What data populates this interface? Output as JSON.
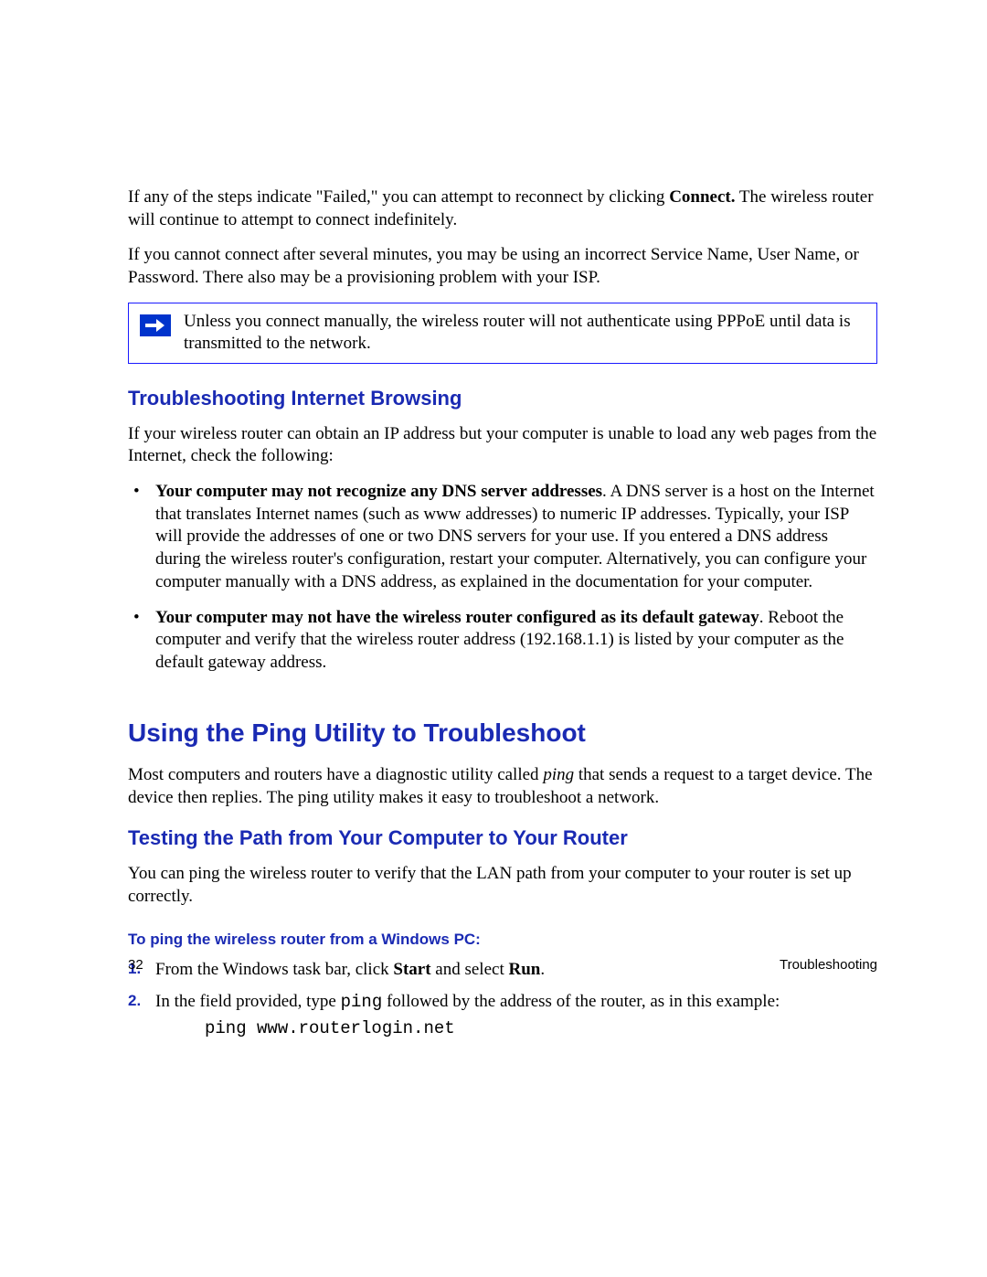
{
  "intro": {
    "p1_a": "If any of the steps indicate \"Failed,\" you can attempt to reconnect by clicking ",
    "p1_b_bold": "Connect.",
    "p1_c": " The wireless router will continue to attempt to connect indefinitely.",
    "p2": "If you cannot connect after several minutes, you may be using an incorrect Service Name, User Name, or Password. There also may be a provisioning problem with your ISP."
  },
  "note": {
    "text": "Unless you connect manually, the wireless router will not authenticate using PPPoE until data is transmitted to the network."
  },
  "sec1": {
    "heading": "Troubleshooting Internet Browsing",
    "para": "If your wireless router can obtain an IP address but your computer is unable to load any web pages from the Internet, check the following:",
    "b1_bold": "Your computer may not recognize any DNS server addresses",
    "b1_rest": ". A DNS server is a host on the Internet that translates Internet names (such as www addresses) to numeric IP addresses. Typically, your ISP will provide the addresses of one or two DNS servers for your use. If you entered a DNS address during the wireless router's configuration, restart your computer. Alternatively, you can configure your computer manually with a DNS address, as explained in the documentation for your computer.",
    "b2_bold": "Your computer may not have the wireless router configured as its default gateway",
    "b2_rest": ". Reboot the computer and verify that the wireless router address (192.168.1.1) is listed by your computer as the default gateway address."
  },
  "sec2": {
    "heading": "Using the Ping Utility to Troubleshoot",
    "p_a": "Most computers and routers have a diagnostic utility called ",
    "p_b_italic": "ping",
    "p_c": " that sends a request to a target device. The device then replies. The ping utility makes it easy to troubleshoot a network."
  },
  "sec3": {
    "heading": "Testing the Path from Your Computer to Your Router",
    "para": "You can ping the wireless router to verify that the LAN path from your computer to your router is set up correctly.",
    "proc_heading": "To ping the wireless router from a Windows PC:",
    "step1_a": "From the Windows task bar, click ",
    "step1_b_bold": "Start",
    "step1_c": " and select ",
    "step1_d_bold": "Run",
    "step1_e": ".",
    "step2_a": "In the field provided, type ",
    "step2_b_mono": "ping",
    "step2_c": " followed by the address of the router, as in this example:",
    "step2_example": "ping www.routerlogin.net"
  },
  "footer": {
    "page_number": "32",
    "section": "Troubleshooting"
  }
}
